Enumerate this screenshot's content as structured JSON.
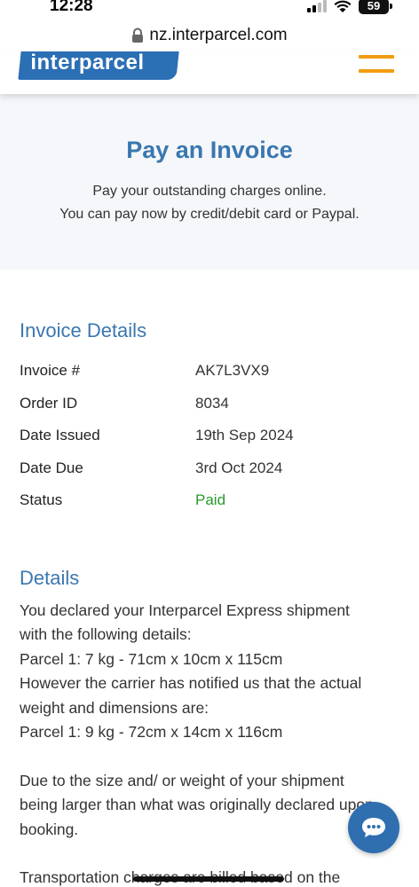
{
  "status_bar": {
    "time": "12:28",
    "battery": "59"
  },
  "browser": {
    "url": "nz.interparcel.com"
  },
  "header": {
    "logo_text": "interparcel"
  },
  "hero": {
    "title": "Pay an Invoice",
    "line1": "Pay your outstanding charges online.",
    "line2": "You can pay now by credit/debit card or Paypal."
  },
  "invoice_details": {
    "title": "Invoice Details",
    "rows": [
      {
        "label": "Invoice #",
        "value": "AK7L3VX9"
      },
      {
        "label": "Order ID",
        "value": "8034"
      },
      {
        "label": "Date Issued",
        "value": "19th Sep 2024"
      },
      {
        "label": "Date Due",
        "value": "3rd Oct 2024"
      },
      {
        "label": "Status",
        "value": "Paid"
      }
    ],
    "status_color": "#2a9a2a"
  },
  "details": {
    "title": "Details",
    "paragraph1": [
      "You declared your Interparcel Express shipment",
      "with the following details:",
      "Parcel 1: 7 kg - 71cm x 10cm x 115cm",
      "However the carrier has notified us that the actual",
      "weight and dimensions are:",
      "Parcel 1: 9 kg - 72cm x 14cm x 116cm"
    ],
    "paragraph2": [
      "Due to the size and/ or weight of your shipment",
      "being larger than what was originally declared upon",
      "booking."
    ],
    "paragraph3": [
      "Transportation charges are billed based on the"
    ]
  },
  "icons": {
    "lock": "lock-icon",
    "menu": "hamburger-menu-icon",
    "chat": "chat-bubble-icon"
  },
  "colors": {
    "brand_blue": "#3a77b0",
    "accent_orange": "#f39c12"
  }
}
